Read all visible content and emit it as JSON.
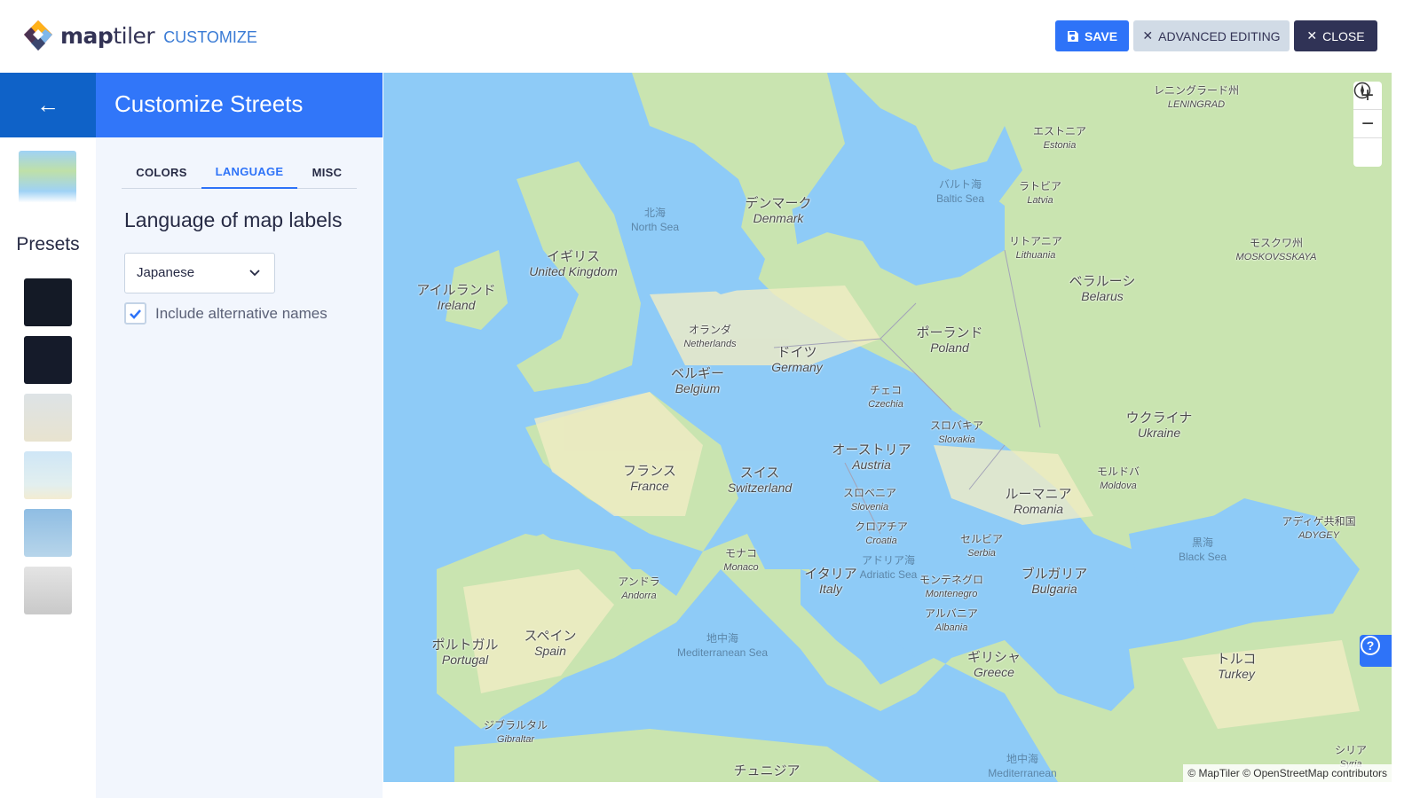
{
  "header": {
    "brand_bold": "map",
    "brand_light": "tiler",
    "product": "CUSTOMIZE",
    "buttons": {
      "save": "SAVE",
      "advanced": "ADVANCED EDITING",
      "close": "CLOSE"
    }
  },
  "leftnav": {
    "presets_label": "Presets",
    "preset_thumbs": [
      "dark",
      "darkmatter",
      "pastel",
      "light-blue",
      "winter",
      "grayscale"
    ]
  },
  "panel": {
    "title": "Customize Streets",
    "tabs": [
      {
        "label": "COLORS"
      },
      {
        "label": "LANGUAGE",
        "active": true
      },
      {
        "label": "MISC"
      }
    ],
    "heading": "Language of map labels",
    "language_select": "Japanese",
    "alt_names_label": "Include alternative names",
    "alt_names_checked": true
  },
  "map": {
    "attribution": "© MapTiler © OpenStreetMap contributors",
    "colors": {
      "water": "#8ecbf7",
      "land": "#c9e4b0",
      "lowland": "#f1ecc4"
    },
    "labels": [
      {
        "ja": "レニングラード州",
        "en": "LENINGRAD"
      },
      {
        "ja": "エストニア",
        "en": "Estonia"
      },
      {
        "ja": "バルト海",
        "en": "Baltic Sea"
      },
      {
        "ja": "ラトビア",
        "en": "Latvia"
      },
      {
        "ja": "デンマーク",
        "en": "Denmark"
      },
      {
        "ja": "北海",
        "en": "North Sea"
      },
      {
        "ja": "リトアニア",
        "en": "Lithuania"
      },
      {
        "ja": "モスクワ州",
        "en": "MOSKOVSSKAYA"
      },
      {
        "ja": "イギリス",
        "en": "United Kingdom"
      },
      {
        "ja": "アイルランド",
        "en": "Ireland"
      },
      {
        "ja": "ベラルーシ",
        "en": "Belarus"
      },
      {
        "ja": "オランダ",
        "en": "Netherlands"
      },
      {
        "ja": "ポーランド",
        "en": "Poland"
      },
      {
        "ja": "ドイツ",
        "en": "Germany"
      },
      {
        "ja": "ベルギー",
        "en": "Belgium"
      },
      {
        "ja": "チェコ",
        "en": "Czechia"
      },
      {
        "ja": "ウクライナ",
        "en": "Ukraine"
      },
      {
        "ja": "スロバキア",
        "en": "Slovakia"
      },
      {
        "ja": "オーストリア",
        "en": "Austria"
      },
      {
        "ja": "フランス",
        "en": "France"
      },
      {
        "ja": "スイス",
        "en": "Switzerland"
      },
      {
        "ja": "モルドバ",
        "en": "Moldova"
      },
      {
        "ja": "スロベニア",
        "en": "Slovenia"
      },
      {
        "ja": "ルーマニア",
        "en": "Romania"
      },
      {
        "ja": "クロアチア",
        "en": "Croatia"
      },
      {
        "ja": "アディゲ共和国",
        "en": "ADYGEY"
      },
      {
        "ja": "セルビア",
        "en": "Serbia"
      },
      {
        "ja": "モナコ",
        "en": "Monaco"
      },
      {
        "ja": "黒海",
        "en": "Black Sea"
      },
      {
        "ja": "アンドラ",
        "en": "Andorra"
      },
      {
        "ja": "イタリア",
        "en": "Italy"
      },
      {
        "ja": "アドリア海",
        "en": "Adriatic Sea"
      },
      {
        "ja": "モンテネグロ",
        "en": "Montenegro"
      },
      {
        "ja": "ブルガリア",
        "en": "Bulgaria"
      },
      {
        "ja": "アルバニア",
        "en": "Albania"
      },
      {
        "ja": "ポルトガル",
        "en": "Portugal"
      },
      {
        "ja": "スペイン",
        "en": "Spain"
      },
      {
        "ja": "地中海",
        "en": "Mediterranean Sea"
      },
      {
        "ja": "ギリシャ",
        "en": "Greece"
      },
      {
        "ja": "トルコ",
        "en": "Turkey"
      },
      {
        "ja": "ジブラルタル",
        "en": "Gibraltar"
      },
      {
        "ja": "地中海",
        "en": "Mediterranean"
      },
      {
        "ja": "チュニジア",
        "en": ""
      },
      {
        "ja": "シリア",
        "en": "Syria"
      }
    ]
  }
}
